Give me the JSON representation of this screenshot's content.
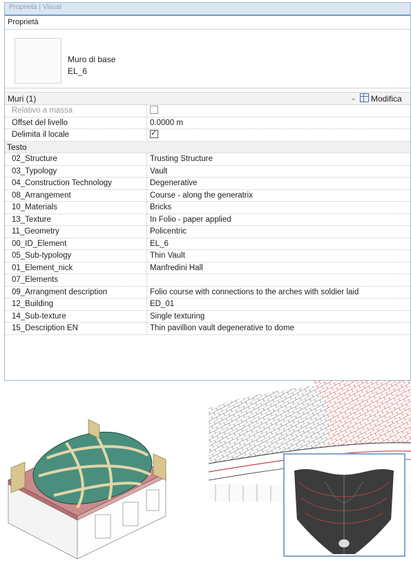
{
  "panel": {
    "top_strip": "Proprietà | Visual",
    "title": "Proprietà",
    "type_family": "Muro di base",
    "type_name": "EL_6",
    "selector": "Muri (1)",
    "edit_type": "Modifica"
  },
  "rows": [
    {
      "key": "Relativo a massa",
      "value": "",
      "checkbox": "off",
      "dim": true
    },
    {
      "key": "Offset del livello",
      "value": "0.0000 m"
    },
    {
      "key": "Delimita il locale",
      "value": "",
      "checkbox": "on"
    },
    {
      "group": "Testo"
    },
    {
      "key": "02_Structure",
      "value": "Trusting Structure"
    },
    {
      "key": "03_Typology",
      "value": "Vault"
    },
    {
      "key": "04_Construction Technology",
      "value": "Degenerative"
    },
    {
      "key": "08_Arrangement",
      "value": "Course - along the generatrix"
    },
    {
      "key": "10_Materials",
      "value": "Bricks"
    },
    {
      "key": "13_Texture",
      "value": "In Folio - paper applied"
    },
    {
      "key": "11_Geometry",
      "value": "Policentric"
    },
    {
      "key": "00_ID_Element",
      "value": "EL_6"
    },
    {
      "key": "05_Sub-typology",
      "value": "Thin Vault"
    },
    {
      "key": "01_Element_nick",
      "value": "Manfredini Hall"
    },
    {
      "key": "07_Elements",
      "value": ""
    },
    {
      "key": "09_Arrangment description",
      "value": "Folio course with connections to the arches with soldier laid"
    },
    {
      "key": "12_Building",
      "value": "ED_01"
    },
    {
      "key": "14_Sub-texture",
      "value": "Single texturing"
    },
    {
      "key": "15_Description EN",
      "value": "Thin pavillion vault degenerative to dome"
    }
  ],
  "colors": {
    "accent_border": "#7fa7d3",
    "vault_green": "#4a8f7e",
    "vault_pink": "#c98a8a",
    "rib_tan": "#e2d6a8"
  },
  "icons": [
    "chevron-down-icon",
    "edit-type-icon",
    "checkbox-icon"
  ]
}
